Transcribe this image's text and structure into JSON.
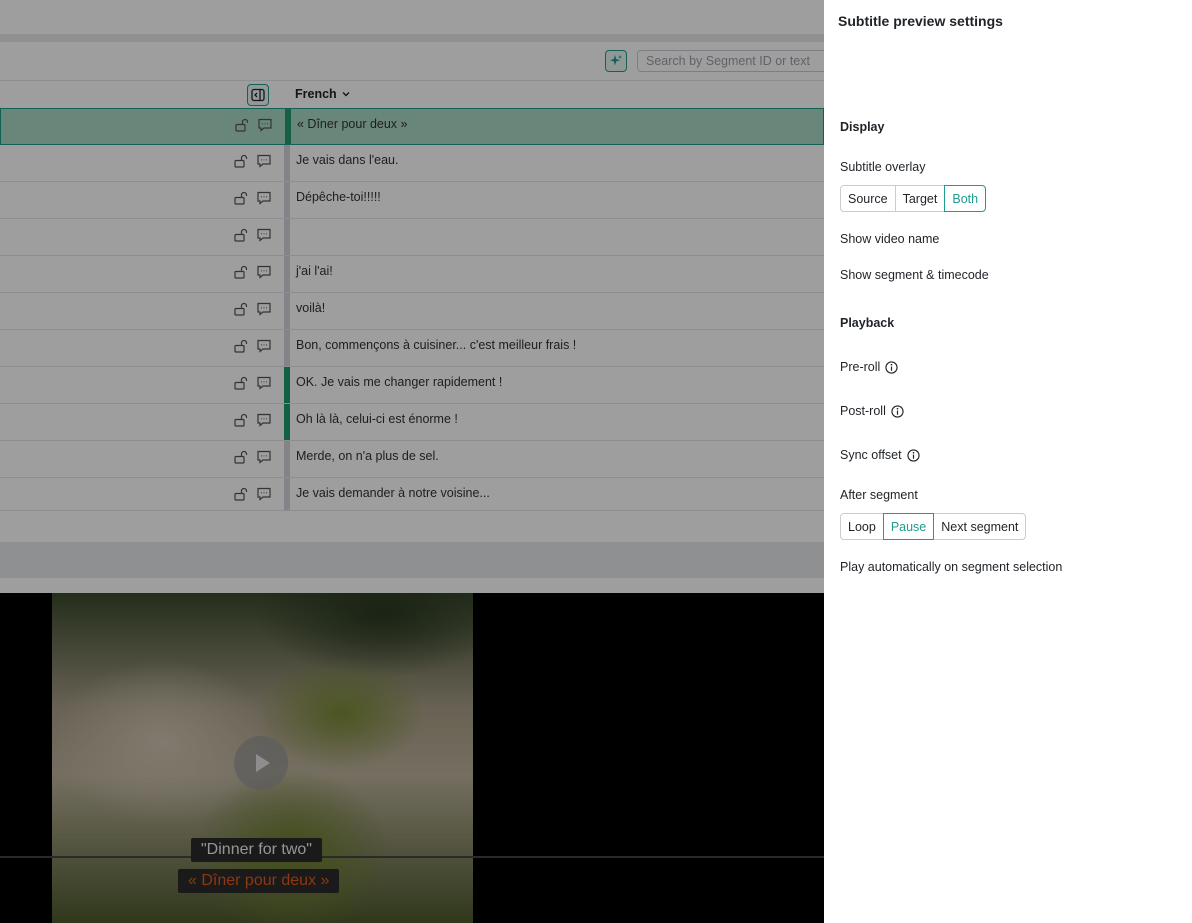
{
  "toolbar": {
    "search_placeholder": "Search by Segment ID or text"
  },
  "table": {
    "language": "French",
    "rows": [
      {
        "text": "« Dîner pour deux »",
        "selected": true,
        "marker": "green"
      },
      {
        "text": "Je vais dans l'eau.",
        "selected": false,
        "marker": "gray"
      },
      {
        "text": "Dépêche-toi!!!!!",
        "selected": false,
        "marker": "gray"
      },
      {
        "text": "",
        "selected": false,
        "marker": "gray"
      },
      {
        "text": "j'ai l'ai!",
        "selected": false,
        "marker": "gray"
      },
      {
        "text": "voilà!",
        "selected": false,
        "marker": "gray"
      },
      {
        "text": "Bon, commençons à cuisiner... c'est meilleur frais !",
        "selected": false,
        "marker": "gray"
      },
      {
        "text": "OK. Je vais me changer rapidement !",
        "selected": false,
        "marker": "green"
      },
      {
        "text": "Oh là là, celui-ci est énorme !",
        "selected": false,
        "marker": "green"
      },
      {
        "text": "Merde, on n'a plus de sel.",
        "selected": false,
        "marker": "gray"
      },
      {
        "text": "Je vais demander à notre voisine...",
        "selected": false,
        "marker": "gray"
      }
    ]
  },
  "video": {
    "subtitle_source": "\"Dinner for two\"",
    "subtitle_target": "« Dîner pour deux »"
  },
  "panel": {
    "title": "Subtitle preview settings",
    "display_heading": "Display",
    "subtitle_overlay_label": "Subtitle overlay",
    "overlay_options": [
      "Source",
      "Target",
      "Both"
    ],
    "overlay_selected": "Both",
    "show_video_name": "Show video name",
    "show_segment_timecode": "Show segment & timecode",
    "playback_heading": "Playback",
    "preroll_label": "Pre-roll",
    "postroll_label": "Post-roll",
    "sync_offset_label": "Sync offset",
    "after_segment_label": "After segment",
    "after_options": [
      "Loop",
      "Pause",
      "Next segment"
    ],
    "after_selected": "Pause",
    "autoplay_label": "Play automatically on segment selection"
  },
  "colors": {
    "accent": "#1f9c8b",
    "selected_row": "#aad8c6",
    "target_subtitle": "#e55a1c"
  }
}
